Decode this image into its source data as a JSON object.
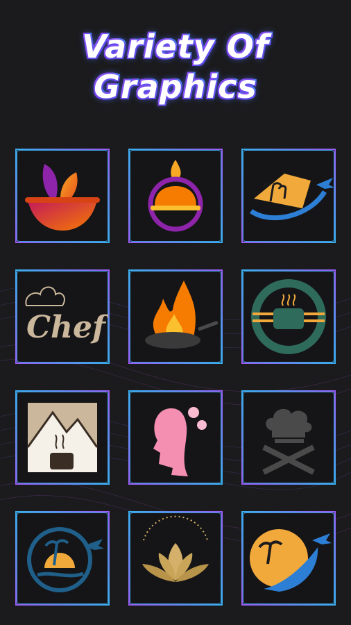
{
  "title": {
    "line1": "Variety Of",
    "line2": "Graphics"
  },
  "tiles": [
    {
      "icon": "leaf-bowl-icon"
    },
    {
      "icon": "cloche-flame-icon"
    },
    {
      "icon": "palm-plane-icon"
    },
    {
      "icon": "chef-script-icon",
      "text": "Chef"
    },
    {
      "icon": "flaming-pan-icon"
    },
    {
      "icon": "coffee-cup-circle-icon"
    },
    {
      "icon": "mountain-coffee-icon"
    },
    {
      "icon": "woman-flowers-icon"
    },
    {
      "icon": "chef-hat-spatulas-icon"
    },
    {
      "icon": "island-plane-circle-icon"
    },
    {
      "icon": "lotus-icon"
    },
    {
      "icon": "sunset-plane-icon"
    }
  ],
  "colors": {
    "accent_orange": "#f2a93b",
    "accent_purple": "#8a4df0",
    "accent_blue": "#2d7fd6",
    "border": "#8a6cf0"
  }
}
